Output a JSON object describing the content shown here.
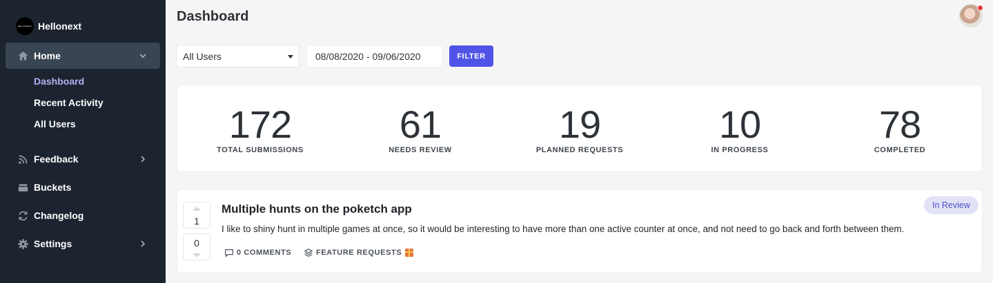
{
  "sidebar": {
    "brand": {
      "logo_text": "HELLONEXT",
      "name": "Hellonext"
    },
    "items": [
      {
        "label": "Home",
        "icon": "home-icon"
      },
      {
        "label": "Feedback",
        "icon": "rss-icon"
      },
      {
        "label": "Buckets",
        "icon": "buckets-icon"
      },
      {
        "label": "Changelog",
        "icon": "changelog-icon"
      },
      {
        "label": "Settings",
        "icon": "gear-icon"
      }
    ],
    "home_subitems": [
      {
        "label": "Dashboard"
      },
      {
        "label": "Recent Activity"
      },
      {
        "label": "All Users"
      }
    ]
  },
  "header": {
    "title": "Dashboard"
  },
  "filters": {
    "user_select": "All Users",
    "date_range": "08/08/2020 - 09/06/2020",
    "filter_label": "FILTER"
  },
  "stats": [
    {
      "value": "172",
      "label": "TOTAL SUBMISSIONS"
    },
    {
      "value": "61",
      "label": "NEEDS REVIEW"
    },
    {
      "value": "19",
      "label": "PLANNED REQUESTS"
    },
    {
      "value": "10",
      "label": "IN PROGRESS"
    },
    {
      "value": "78",
      "label": "COMPLETED"
    }
  ],
  "post": {
    "upvotes": "1",
    "downvotes": "0",
    "title": "Multiple hunts on the poketch app",
    "body": "I like to shiny hunt in multiple games at once, so it would be interesting to have more than one active counter at once, and not need to go back and forth between them.",
    "status": "In Review",
    "comments": "0 COMMENTS",
    "bucket": "FEATURE REQUESTS"
  },
  "colors": {
    "sidebar_bg": "#1c2430",
    "accent": "#4f54e6",
    "active_sub": "#b3b0f2"
  }
}
